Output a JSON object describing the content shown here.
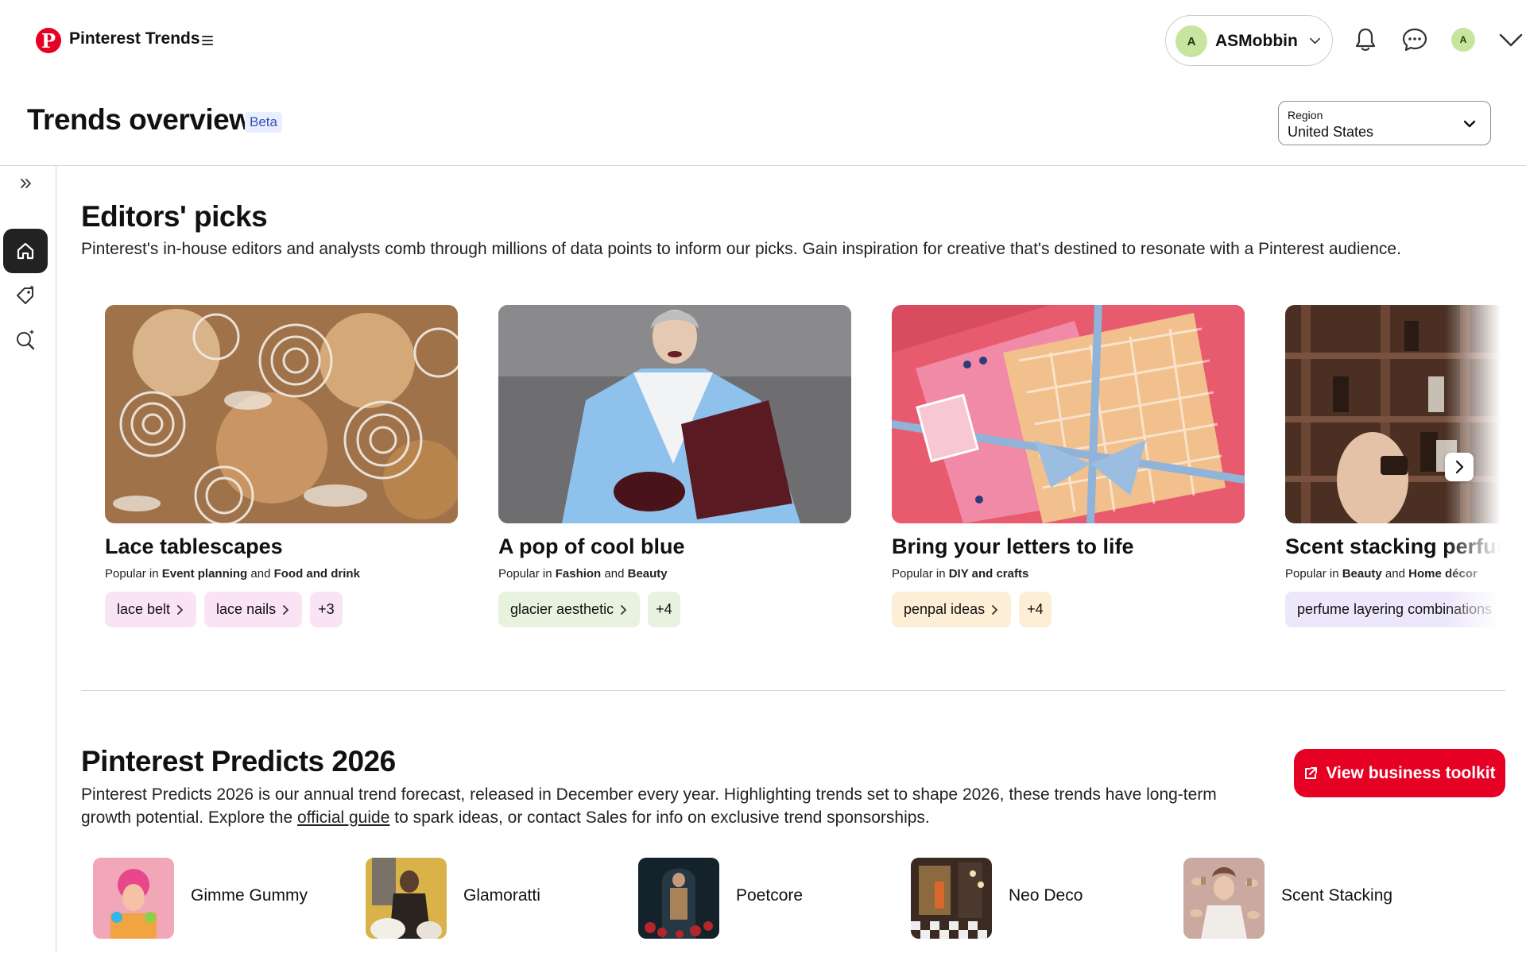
{
  "app": {
    "brand": "Pinterest Trends",
    "logo_letter": "P"
  },
  "account": {
    "initial": "A",
    "name": "ASMobbin"
  },
  "header": {
    "title": "Trends overview",
    "badge": "Beta"
  },
  "region": {
    "label": "Region",
    "value": "United States"
  },
  "editors_picks": {
    "title": "Editors' picks",
    "description": "Pinterest's in-house editors and analysts comb through millions of data points to inform our picks. Gain inspiration for creative that's destined to resonate with a Pinterest audience.",
    "cards": [
      {
        "title": "Lace tablescapes",
        "popular_prefix": "Popular in",
        "cat1": "Event planning",
        "joiner": "and",
        "cat2": "Food and drink",
        "chips": [
          "lace belt",
          "lace nails"
        ],
        "more": "+3"
      },
      {
        "title": "A pop of cool blue",
        "popular_prefix": "Popular in",
        "cat1": "Fashion",
        "joiner": "and",
        "cat2": "Beauty",
        "chips": [
          "glacier aesthetic"
        ],
        "more": "+4"
      },
      {
        "title": "Bring your letters to life",
        "popular_prefix": "Popular in",
        "cat1": "DIY and crafts",
        "joiner": "",
        "cat2": "",
        "chips": [
          "penpal ideas"
        ],
        "more": "+4"
      },
      {
        "title": "Scent stacking perfum",
        "popular_prefix": "Popular in",
        "cat1": "Beauty",
        "joiner": "and",
        "cat2": "Home décor",
        "chips": [
          "perfume layering combinations"
        ],
        "more": ""
      }
    ]
  },
  "predicts": {
    "title": "Pinterest Predicts 2026",
    "desc_line1": "Pinterest Predicts 2026 is our annual trend forecast, released in December every year. Highlighting trends set to shape 2026, these trends have long-term",
    "desc_line2_before": "growth potential. Explore the",
    "desc_link": "official guide",
    "desc_line2_after": "to spark ideas, or contact Sales for info on exclusive trend sponsorships.",
    "toolkit_button": "View business toolkit",
    "trends": [
      "Gimme Gummy",
      "Glamoratti",
      "Poetcore",
      "Neo Deco",
      "Scent Stacking"
    ]
  },
  "colors": {
    "brand_red": "#e60023",
    "avatar_green": "#c7e59e",
    "chip_pink": "#fbe3f6",
    "chip_green": "#e8f3df",
    "chip_peach": "#fdefd6",
    "chip_lavender": "#ede7fb"
  },
  "icons": [
    "pinterest-logo",
    "hamburger-icon",
    "chevron-down-icon",
    "bell-icon",
    "chat-icon",
    "expand-icon",
    "home-icon",
    "tag-icon",
    "search-sparkle-icon",
    "chevron-right-icon",
    "external-link-icon"
  ]
}
